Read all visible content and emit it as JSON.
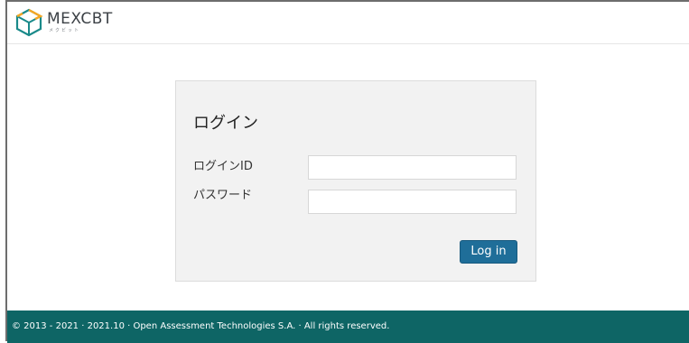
{
  "header": {
    "logo_text": "MEXCBT",
    "logo_subtext": "メクビット",
    "logo_icon": "cube-icon"
  },
  "login": {
    "title": "ログイン",
    "id_label": "ログインID",
    "id_value": "",
    "password_label": "パスワード",
    "password_value": "",
    "submit_label": "Log in"
  },
  "footer": {
    "copyright": "© 2013 - 2021 · 2021.10 · Open Assessment Technologies S.A. · All rights reserved."
  },
  "colors": {
    "footer_bg": "#0e6565",
    "button_bg": "#1f6e99",
    "login_panel_bg": "#f2f2f2",
    "logo_accent": "#f5a623",
    "logo_primary": "#1a8a8a"
  }
}
